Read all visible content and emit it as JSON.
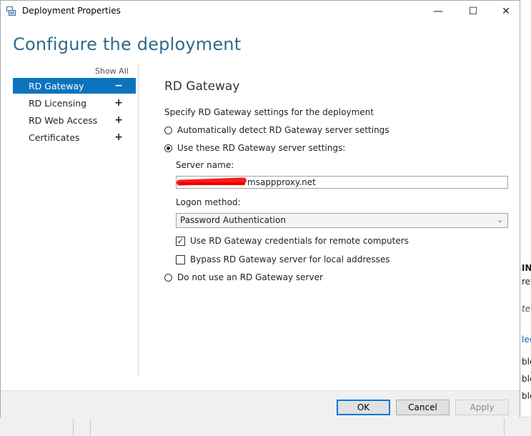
{
  "window": {
    "title": "Deployment Properties",
    "minimize": "—",
    "maximize": "☐",
    "close": "✕"
  },
  "heading": "Configure the deployment",
  "nav": {
    "show_all": "Show All",
    "items": [
      {
        "label": "RD Gateway",
        "sign": "−",
        "active": true
      },
      {
        "label": "RD Licensing",
        "sign": "+"
      },
      {
        "label": "RD Web Access",
        "sign": "+"
      },
      {
        "label": "Certificates",
        "sign": "+"
      }
    ]
  },
  "rd_gateway": {
    "title": "RD Gateway",
    "description": "Specify RD Gateway settings for the deployment",
    "options": [
      {
        "label": "Automatically detect RD Gateway server settings",
        "checked": false
      },
      {
        "label": "Use these RD Gateway server settings:",
        "checked": true
      },
      {
        "label": "Do not use an RD Gateway server",
        "checked": false
      }
    ],
    "server_name_label": "Server name:",
    "server_name_value": "msappproxy.net",
    "logon_method_label": "Logon method:",
    "logon_method_value": "Password Authentication",
    "checkboxes": [
      {
        "label": "Use RD Gateway credentials for remote computers",
        "checked": true,
        "mark": "✓"
      },
      {
        "label": "Bypass RD Gateway server for local addresses",
        "checked": false,
        "mark": ""
      }
    ]
  },
  "footer": {
    "ok": "OK",
    "cancel": "Cancel",
    "apply": "Apply"
  },
  "background_window": {
    "fragments": [
      "IN",
      "ref",
      "te",
      "lec",
      "ble",
      "ble",
      "ble"
    ]
  },
  "colors": {
    "accent": "#0d73bf",
    "heading": "#2f6b8b",
    "redaction": "#ff1a1a"
  }
}
